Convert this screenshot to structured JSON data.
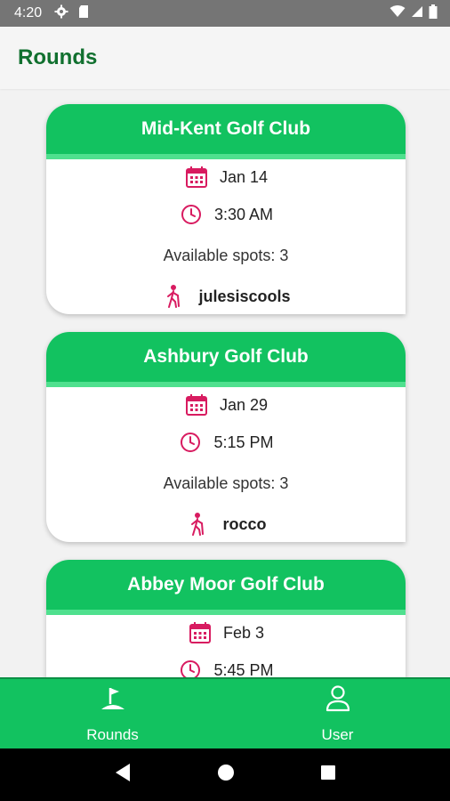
{
  "status_bar": {
    "time": "4:20",
    "icons_left": [
      "gear-icon",
      "sd-card-icon"
    ],
    "icons_right": [
      "wifi-icon",
      "signal-icon",
      "battery-icon"
    ]
  },
  "app_bar": {
    "title": "Rounds"
  },
  "rounds": [
    {
      "club": "Mid-Kent Golf Club",
      "date": "Jan 14",
      "time": "3:30 AM",
      "spots": "Available spots: 3",
      "user": "julesiscools"
    },
    {
      "club": "Ashbury Golf Club",
      "date": "Jan 29",
      "time": "5:15 PM",
      "spots": "Available spots: 3",
      "user": "rocco"
    },
    {
      "club": "Abbey Moor Golf Club",
      "date": "Feb 3",
      "time": "5:45 PM",
      "spots": "",
      "user": ""
    }
  ],
  "bottom_nav": {
    "items": [
      {
        "label": "Rounds",
        "icon": "golf-flag-icon"
      },
      {
        "label": "User",
        "icon": "person-icon"
      }
    ]
  },
  "colors": {
    "primary": "#12c260",
    "accent_stripe": "#4fe08e",
    "title_green": "#11702f",
    "icon_pink": "#d81b60"
  }
}
